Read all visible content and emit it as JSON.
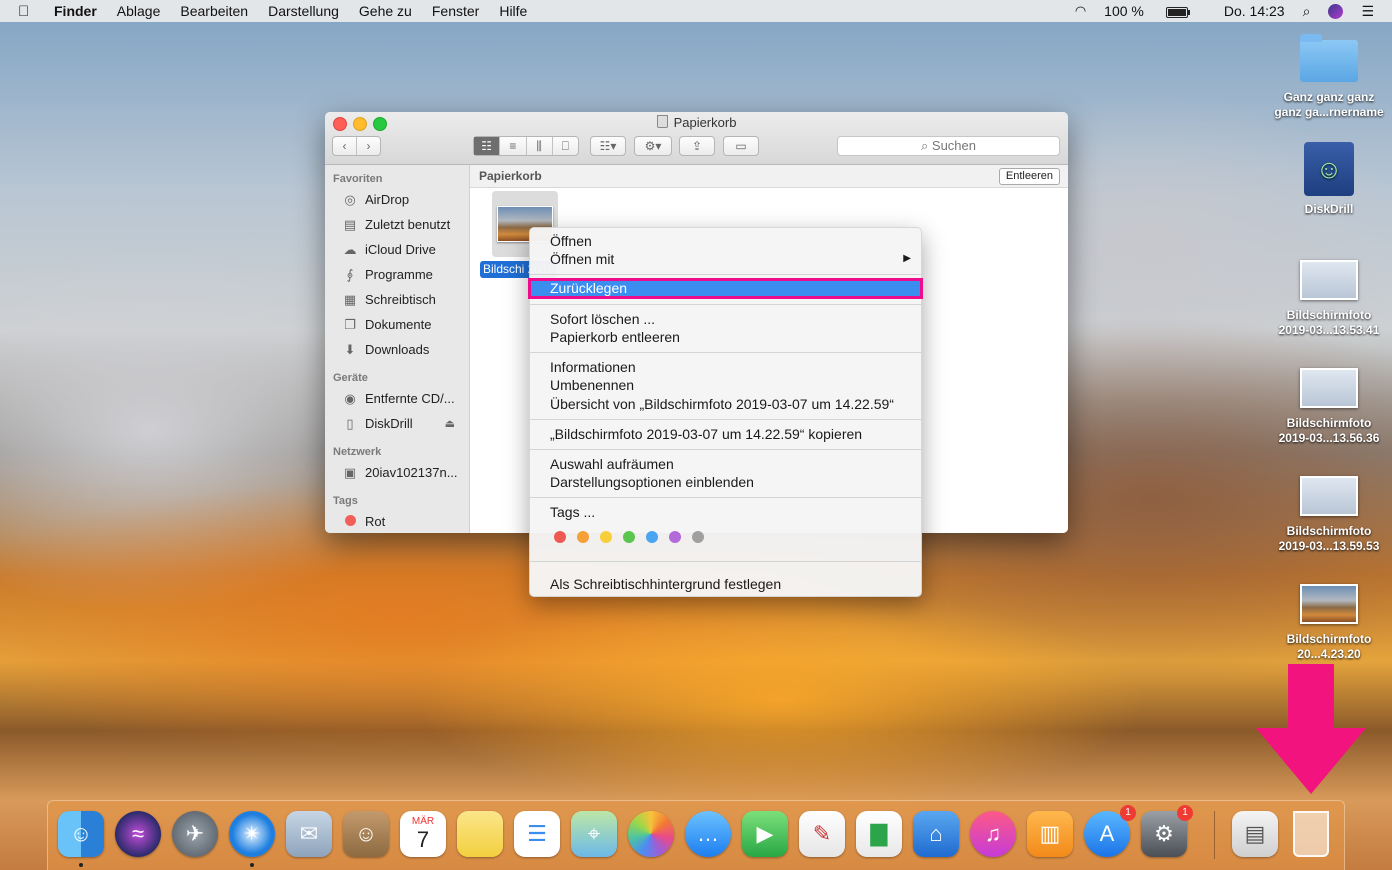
{
  "menubar": {
    "app": "Finder",
    "items": [
      "Ablage",
      "Bearbeiten",
      "Darstellung",
      "Gehe zu",
      "Fenster",
      "Hilfe"
    ],
    "battery": "100 %",
    "clock": "Do. 14:23"
  },
  "window": {
    "title": "Papierkorb",
    "search_placeholder": "Suchen",
    "path_title": "Papierkorb",
    "empty_button": "Entleeren",
    "file_label": "Bildschi 2019-0..."
  },
  "sidebar": {
    "favorites_title": "Favoriten",
    "favorites": [
      {
        "label": "AirDrop",
        "icon": "airdrop-icon"
      },
      {
        "label": "Zuletzt benutzt",
        "icon": "recent-icon"
      },
      {
        "label": "iCloud Drive",
        "icon": "cloud-icon"
      },
      {
        "label": "Programme",
        "icon": "apps-icon"
      },
      {
        "label": "Schreibtisch",
        "icon": "desktop-icon"
      },
      {
        "label": "Dokumente",
        "icon": "document-icon"
      },
      {
        "label": "Downloads",
        "icon": "download-icon"
      }
    ],
    "devices_title": "Geräte",
    "devices": [
      {
        "label": "Entfernte CD/...",
        "icon": "cd-icon"
      },
      {
        "label": "DiskDrill",
        "icon": "drive-icon"
      }
    ],
    "network_title": "Netzwerk",
    "network": [
      {
        "label": "20iav102137n...",
        "icon": "computer-icon"
      }
    ],
    "tags_title": "Tags",
    "tags": [
      {
        "label": "Rot",
        "color": "#f25f58"
      }
    ]
  },
  "context_menu": {
    "open": "Öffnen",
    "open_with": "Öffnen mit",
    "put_back": "Zurücklegen",
    "delete_now": "Sofort löschen ...",
    "empty_trash": "Papierkorb entleeren",
    "info": "Informationen",
    "rename": "Umbenennen",
    "overview": "Übersicht von „Bildschirmfoto 2019-03-07 um 14.22.59“",
    "copy": "„Bildschirmfoto 2019-03-07 um 14.22.59“ kopieren",
    "cleanup": "Auswahl aufräumen",
    "view_options": "Darstellungsoptionen einblenden",
    "tags": "Tags ...",
    "tag_colors": [
      "#ee5a52",
      "#f6a038",
      "#f8cf3b",
      "#5bc64e",
      "#4aa5f0",
      "#b36ad9",
      "#a0a0a0"
    ],
    "wallpaper": "Als Schreibtischhintergrund festlegen"
  },
  "desktop": [
    {
      "label": "Ganz ganz ganz ganz ga...rnername",
      "type": "folder"
    },
    {
      "label": "DiskDrill",
      "type": "disk"
    },
    {
      "label": "Bildschirmfoto 2019-03...13.53.41",
      "type": "shot"
    },
    {
      "label": "Bildschirmfoto 2019-03...13.56.36",
      "type": "shot"
    },
    {
      "label": "Bildschirmfoto 2019-03...13.59.53",
      "type": "shot"
    },
    {
      "label": "Bildschirmfoto 20...4.23.20",
      "type": "photo"
    }
  ],
  "dock": {
    "calendar_month": "MÄR",
    "calendar_day": "7",
    "appstore_badge": "1",
    "prefs_badge": "1"
  }
}
